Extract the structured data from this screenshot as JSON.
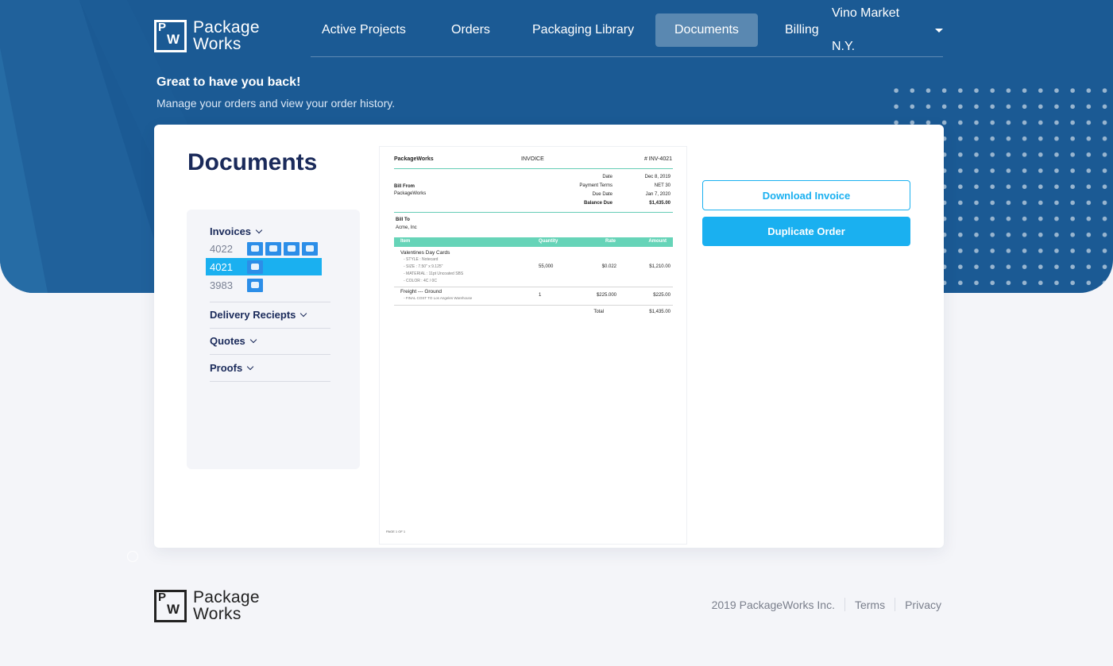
{
  "brand": {
    "line1": "Package",
    "line2": "Works",
    "mark_p": "P",
    "mark_w": "W"
  },
  "nav": {
    "items": [
      "Active Projects",
      "Orders",
      "Packaging Library",
      "Documents",
      "Billing"
    ],
    "active": "Documents",
    "account": "Vino Market N.Y."
  },
  "welcome": {
    "title": "Great to have you back!",
    "subtitle": "Manage your orders and view your order history."
  },
  "documents": {
    "title": "Documents",
    "sections": {
      "invoices": "Invoices",
      "delivery": "Delivery Reciepts",
      "quotes": "Quotes",
      "proofs": "Proofs"
    },
    "invoices": [
      {
        "number": "4022",
        "thumbs": 4,
        "selected": false
      },
      {
        "number": "4021",
        "thumbs": 1,
        "selected": true
      },
      {
        "number": "3983",
        "thumbs": 1,
        "selected": false
      }
    ]
  },
  "invoice": {
    "company": "PackageWorks",
    "label": "INVOICE",
    "number": "# INV-4021",
    "date_label": "Date",
    "date": "Dec 8, 2019",
    "terms_label": "Payment Terms",
    "terms": "NET 30",
    "due_label": "Due Date",
    "due": "Jan 7, 2020",
    "balance_label": "Balance Due",
    "balance": "$1,435.00",
    "bill_from_label": "Bill From",
    "bill_from": "PackageWorks",
    "bill_to_label": "Bill To",
    "bill_to": "Acme, Inc",
    "col_item": "Item",
    "col_qty": "Quantity",
    "col_rate": "Rate",
    "col_amount": "Amount",
    "line1": {
      "name": "Valentines Day Cards",
      "detail1": "- STYLE : Notecard",
      "detail2": "- SIZE : 7.50\" x 9.125\"",
      "detail3": "- MATERIAL : 11pt Uncoated SBS",
      "detail4": "- COLOR : 4C / 0C",
      "qty": "55,000",
      "rate": "$0.022",
      "amount": "$1,210.00"
    },
    "line2": {
      "name": "Freight --- Ground",
      "detail1": "- FINAL COST TO Los Angeles Warehouse",
      "qty": "1",
      "rate": "$225.000",
      "amount": "$225.00"
    },
    "total_label": "Total",
    "total": "$1,435.00",
    "page": "PAGE 1 OF 1"
  },
  "actions": {
    "download": "Download Invoice",
    "duplicate": "Duplicate Order"
  },
  "footer": {
    "copyright": "2019 PackageWorks Inc.",
    "terms": "Terms",
    "privacy": "Privacy"
  },
  "colors": {
    "hero": "#1b5a94",
    "accent": "#1ab0f0",
    "title": "#1a2a5a",
    "table_header": "#66d4b8"
  }
}
